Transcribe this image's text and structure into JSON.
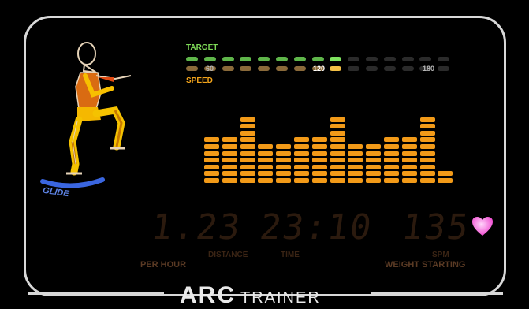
{
  "labels": {
    "target": "TARGET",
    "speed": "SPEED",
    "glide": "GLIDE"
  },
  "speed_ticks": [
    "60",
    "120",
    "180"
  ],
  "target_indicator": {
    "total": 15,
    "lit_count": 9,
    "colors": {
      "lit_target": "#5fb64a",
      "active_target": "#7fe35f",
      "lit_speed": "#8a6a3a",
      "active_speed": "#f3c046",
      "unlit": "#2b2b2b"
    }
  },
  "profile": {
    "bar_color": "#f29a18",
    "segments_per_column": [
      7,
      7,
      10,
      6,
      6,
      7,
      7,
      10,
      6,
      6,
      7,
      7,
      10,
      2
    ]
  },
  "readouts": {
    "speed_value": "1.23",
    "time_value": "23:10",
    "spm_value": "135"
  },
  "readout_labels": {
    "per_hour": "PER HOUR",
    "distance": "DISTANCE",
    "time": "TIME",
    "spm": "SPM",
    "weight_starting": "WEIGHT STARTING"
  },
  "brand": {
    "arc": "ARC",
    "trainer": "TRAINER"
  },
  "icons": {
    "heart": "heart-icon",
    "figure": "stride-figure-icon",
    "glide_arc": "glide-arc-icon"
  },
  "colors": {
    "frame": "#d8d8d8",
    "heart": "#f04ad0"
  }
}
